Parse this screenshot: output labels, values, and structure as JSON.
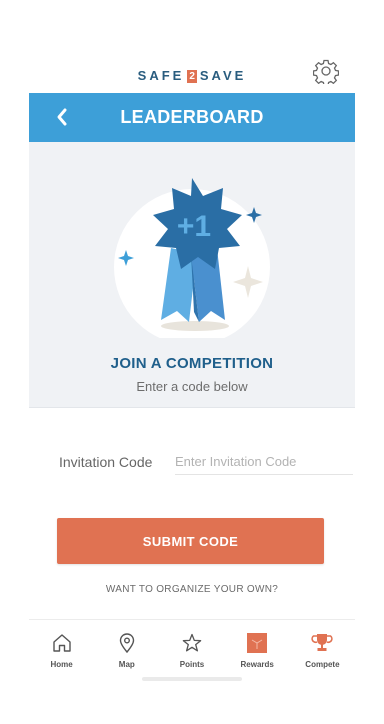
{
  "brand": {
    "prefix": "SAFE",
    "number": "2",
    "suffix": "SAVE"
  },
  "header": {
    "title": "LEADERBOARD"
  },
  "hero": {
    "badge_text": "+1",
    "title": "JOIN A COMPETITION",
    "subtitle": "Enter a code below"
  },
  "form": {
    "label": "Invitation Code",
    "placeholder": "Enter Invitation Code",
    "value": "",
    "submit_label": "SUBMIT CODE"
  },
  "organize_link": "WANT TO ORGANIZE YOUR OWN?",
  "nav": {
    "items": [
      {
        "label": "Home",
        "icon": "home-icon"
      },
      {
        "label": "Map",
        "icon": "map-pin-icon"
      },
      {
        "label": "Points",
        "icon": "star-icon"
      },
      {
        "label": "Rewards",
        "icon": "gift-icon"
      },
      {
        "label": "Compete",
        "icon": "trophy-icon"
      }
    ]
  },
  "colors": {
    "accent_blue": "#3d9fd8",
    "navy": "#2a5d7f",
    "orange": "#e07252"
  }
}
